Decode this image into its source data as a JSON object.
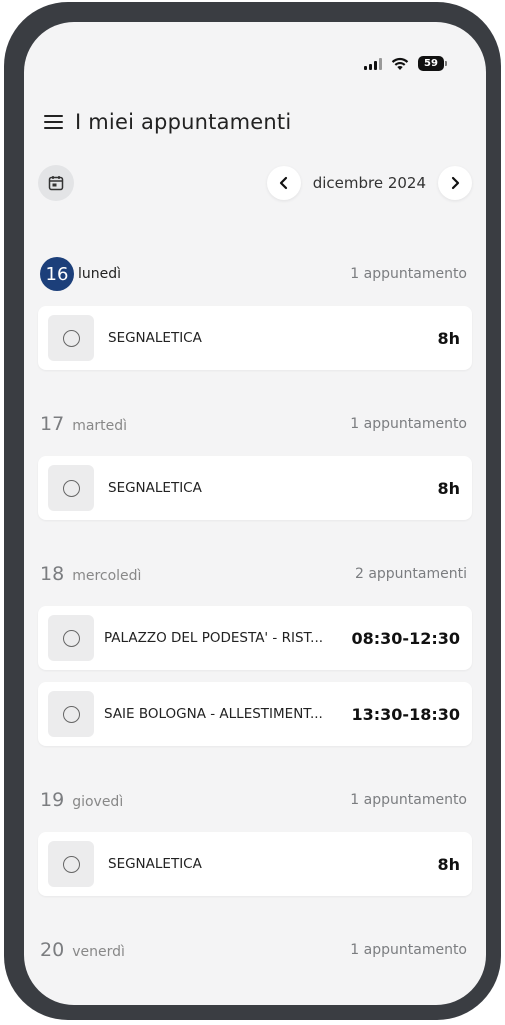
{
  "status_bar": {
    "battery": "59",
    "signal_icon": "signal-icon",
    "wifi_icon": "wifi-icon"
  },
  "header": {
    "title": "I miei appuntamenti",
    "menu_icon": "menu-icon"
  },
  "toolbar": {
    "calendar_icon": "calendar-icon",
    "month": "dicembre 2024",
    "prev_icon": "chevron-left-icon",
    "next_icon": "chevron-right-icon"
  },
  "colors": {
    "today_badge": "#1c3f7a",
    "background": "#f4f4f5",
    "frame": "#3a3d42"
  },
  "days": [
    {
      "num": "16",
      "name": "lunedì",
      "count": "1 appuntamento",
      "today": true,
      "appointments": [
        {
          "title": "SEGNALETICA",
          "time": "8h"
        }
      ]
    },
    {
      "num": "17",
      "name": "martedì",
      "count": "1 appuntamento",
      "appointments": [
        {
          "title": "SEGNALETICA",
          "time": "8h"
        }
      ]
    },
    {
      "num": "18",
      "name": "mercoledì",
      "count": "2 appuntamenti",
      "appointments": [
        {
          "title": "PALAZZO DEL PODESTA' - RIST...",
          "time": "08:30-12:30"
        },
        {
          "title": "SAIE BOLOGNA - ALLESTIMENT...",
          "time": "13:30-18:30"
        }
      ]
    },
    {
      "num": "19",
      "name": "giovedì",
      "count": "1 appuntamento",
      "appointments": [
        {
          "title": "SEGNALETICA",
          "time": "8h"
        }
      ]
    },
    {
      "num": "20",
      "name": "venerdì",
      "count": "1 appuntamento",
      "appointments": []
    }
  ]
}
